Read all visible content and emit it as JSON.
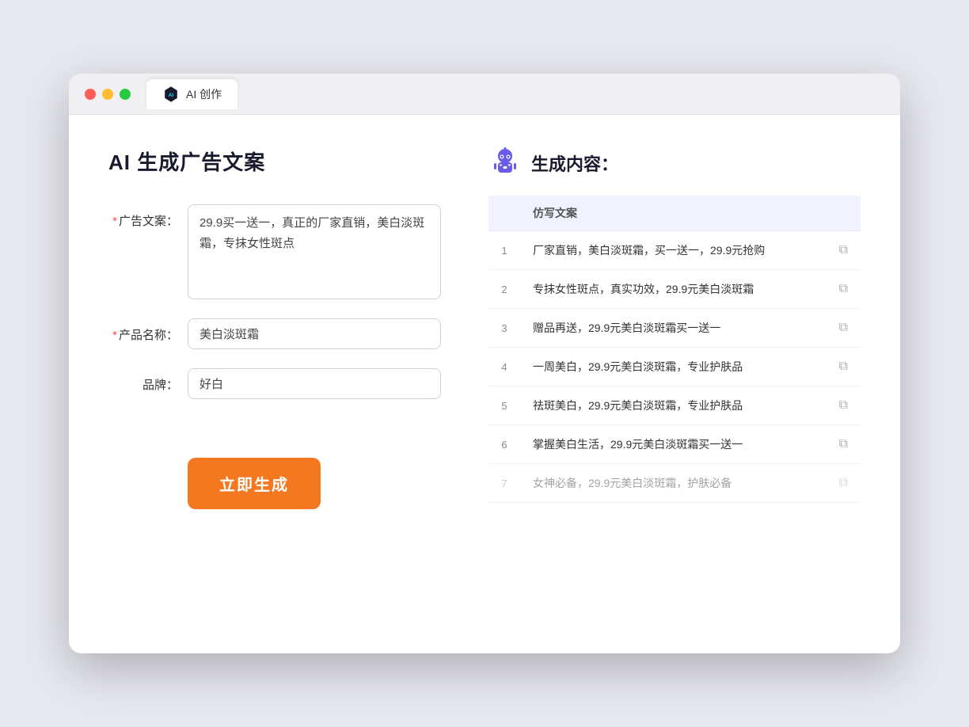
{
  "titlebar": {
    "tab_label": "AI 创作"
  },
  "left_panel": {
    "page_title": "AI 生成广告文案",
    "ad_copy_label": "广告文案：",
    "ad_copy_placeholder": "29.9买一送一，真正的厂家直销，美白淡斑霜，专抹女性斑点",
    "product_name_label": "产品名称：",
    "product_name_value": "美白淡斑霜",
    "brand_label": "品牌：",
    "brand_value": "好白",
    "generate_button": "立即生成"
  },
  "right_panel": {
    "result_title": "生成内容：",
    "table_header": "仿写文案",
    "results": [
      {
        "index": 1,
        "text": "厂家直销，美白淡斑霜，买一送一，29.9元抢购"
      },
      {
        "index": 2,
        "text": "专抹女性斑点，真实功效，29.9元美白淡斑霜"
      },
      {
        "index": 3,
        "text": "赠品再送，29.9元美白淡斑霜买一送一"
      },
      {
        "index": 4,
        "text": "一周美白，29.9元美白淡斑霜，专业护肤品"
      },
      {
        "index": 5,
        "text": "祛斑美白，29.9元美白淡斑霜，专业护肤品"
      },
      {
        "index": 6,
        "text": "掌握美白生活，29.9元美白淡斑霜买一送一"
      },
      {
        "index": 7,
        "text": "女神必备，29.9元美白淡斑霜，护肤必备"
      }
    ]
  }
}
